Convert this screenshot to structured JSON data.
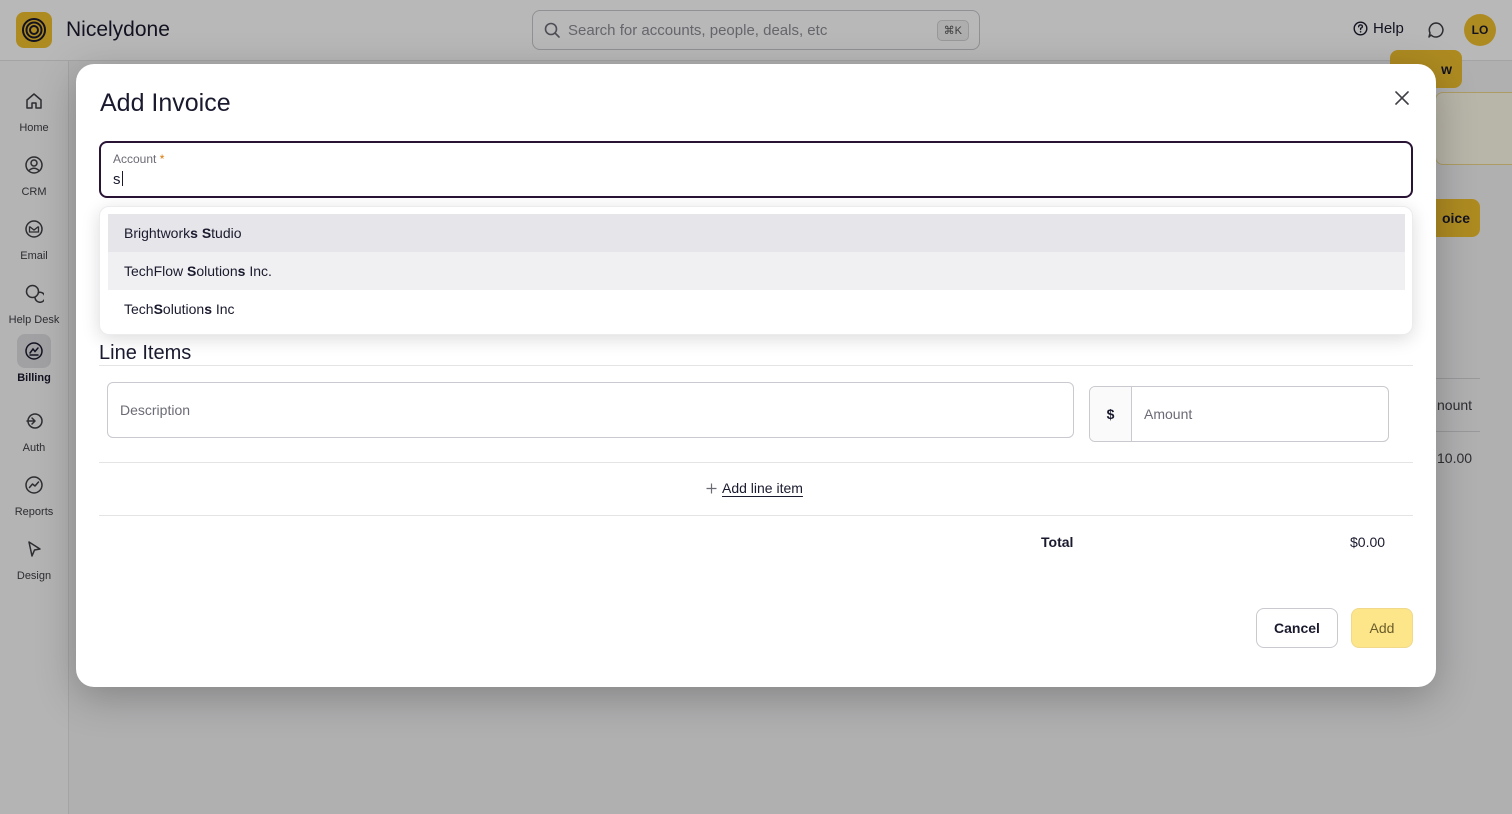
{
  "app": {
    "name": "Nicelydone",
    "avatar_initials": "LO"
  },
  "header": {
    "search_placeholder": "Search for accounts, people, deals, etc",
    "search_shortcut": "⌘K",
    "help_label": "Help"
  },
  "sidebar": {
    "items": [
      {
        "label": "Home",
        "icon": "home-icon"
      },
      {
        "label": "CRM",
        "icon": "user-circle-icon"
      },
      {
        "label": "Email",
        "icon": "mail-icon"
      },
      {
        "label": "Help Desk",
        "icon": "chat-bubbles-icon"
      },
      {
        "label": "Billing",
        "icon": "billing-icon",
        "active": true
      },
      {
        "label": "Auth",
        "icon": "login-icon"
      },
      {
        "label": "Reports",
        "icon": "chart-icon"
      },
      {
        "label": "Design",
        "icon": "cursor-icon"
      }
    ]
  },
  "background": {
    "button1_partial": "w",
    "button2_partial": "oice",
    "column_partial": "nount",
    "value_partial": "10.00"
  },
  "modal": {
    "title": "Add Invoice",
    "account": {
      "label": "Account",
      "required_mark": "*",
      "value": "s"
    },
    "suggestions": [
      {
        "parts": [
          [
            "Brightwork",
            false
          ],
          [
            "s",
            true
          ],
          [
            " ",
            false
          ],
          [
            "S",
            true
          ],
          [
            "tudio",
            false
          ]
        ]
      },
      {
        "parts": [
          [
            "TechFlow ",
            false
          ],
          [
            "S",
            true
          ],
          [
            "olution",
            false
          ],
          [
            "s",
            true
          ],
          [
            " Inc.",
            false
          ]
        ]
      },
      {
        "parts": [
          [
            "Tech",
            false
          ],
          [
            "S",
            true
          ],
          [
            "olution",
            false
          ],
          [
            "s",
            true
          ],
          [
            " Inc",
            false
          ]
        ]
      }
    ],
    "line_items_title": "Line Items",
    "description_placeholder": "Description",
    "currency_symbol": "$",
    "amount_placeholder": "Amount",
    "add_line_item_label": "Add line item",
    "total_label": "Total",
    "total_value": "$0.00",
    "cancel_label": "Cancel",
    "add_label": "Add"
  },
  "colors": {
    "accent": "#f2c12e",
    "focus_border": "#2a1436",
    "required": "#d97706"
  }
}
